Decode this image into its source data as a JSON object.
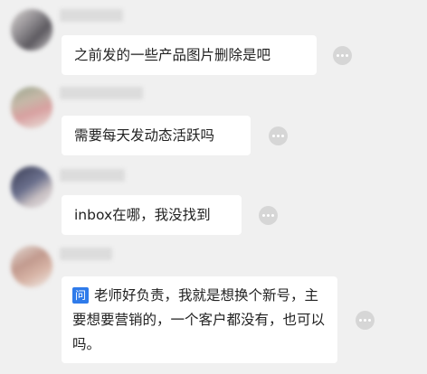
{
  "messages": [
    {
      "text": "之前发的一些产品图片删除是吧"
    },
    {
      "text": "需要每天发动态活跃吗"
    },
    {
      "text": "inbox在哪，我没找到"
    },
    {
      "tag": "问",
      "text": "老师好负责，我就是想换个新号，主要想要营销的，一个客户都没有，也可以吗。"
    }
  ],
  "icons": {
    "more": "more-dots-icon"
  }
}
